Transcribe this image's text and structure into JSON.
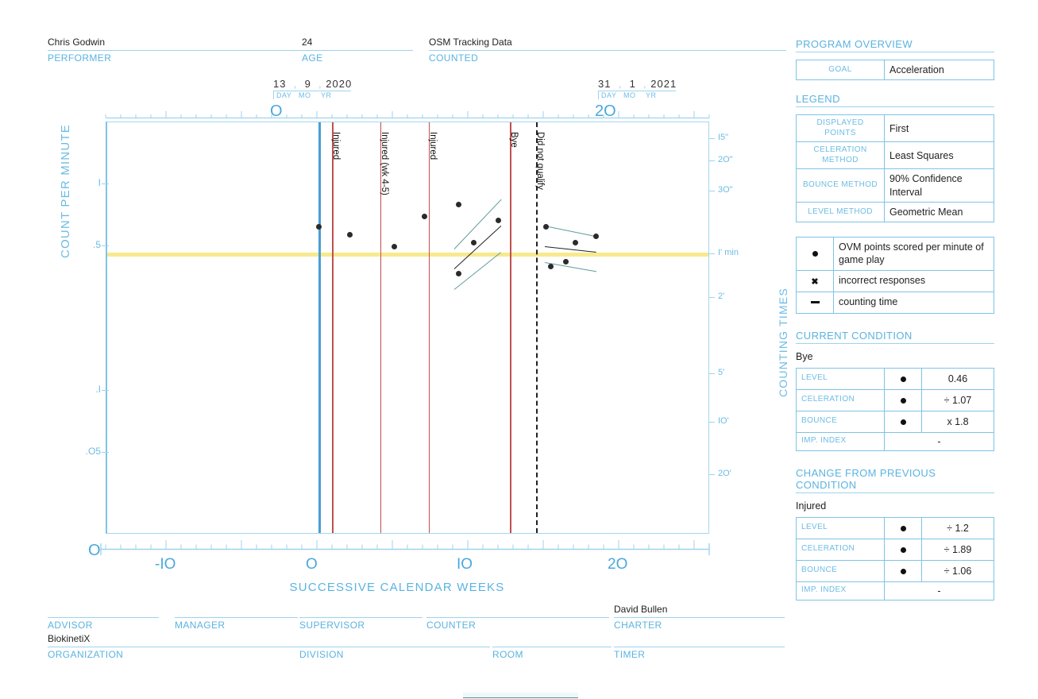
{
  "header": {
    "fields": [
      {
        "name": "performer",
        "label": "PERFORMER",
        "value": "Chris Godwin"
      },
      {
        "name": "age",
        "label": "AGE",
        "value": "24"
      },
      {
        "name": "counted",
        "label": "COUNTED",
        "value": "OSM Tracking Data"
      }
    ],
    "start_date": {
      "day": "13",
      "mo": "9",
      "yr": "2020",
      "units": [
        "DAY",
        "MO",
        "YR"
      ],
      "week": "O"
    },
    "end_date": {
      "day": "31",
      "mo": "1",
      "yr": "2021",
      "units": [
        "DAY",
        "MO",
        "YR"
      ],
      "week": "2O"
    }
  },
  "panel": {
    "program_overview": {
      "title": "PROGRAM OVERVIEW",
      "rows": [
        {
          "key": "GOAL",
          "value": "Acceleration"
        }
      ]
    },
    "legend": {
      "title": "LEGEND",
      "rows": [
        {
          "key": "DISPLAYED POINTS",
          "value": "First"
        },
        {
          "key": "CELERATION METHOD",
          "value": "Least Squares"
        },
        {
          "key": "BOUNCE METHOD",
          "value": "90% Confidence Interval"
        },
        {
          "key": "LEVEL METHOD",
          "value": "Geometric Mean"
        }
      ],
      "symbols": [
        {
          "symbol": "dot",
          "label": "OVM points scored per minute of game play"
        },
        {
          "symbol": "cross",
          "label": "incorrect responses"
        },
        {
          "symbol": "dash",
          "label": "counting time"
        }
      ]
    },
    "current_condition": {
      "title": "CURRENT CONDITION",
      "condition": "Bye",
      "rows": [
        {
          "key": "LEVEL",
          "symbol": "dot",
          "value": "0.46"
        },
        {
          "key": "CELERATION",
          "symbol": "dot",
          "value": "÷ 1.07"
        },
        {
          "key": "BOUNCE",
          "symbol": "dot",
          "value": "x 1.8"
        },
        {
          "key": "IMP. INDEX",
          "symbol": "",
          "value": "-"
        }
      ]
    },
    "change_from_previous": {
      "title": "CHANGE FROM PREVIOUS CONDITION",
      "condition": "Injured",
      "rows": [
        {
          "key": "LEVEL",
          "symbol": "dot",
          "value": "÷ 1.2"
        },
        {
          "key": "CELERATION",
          "symbol": "dot",
          "value": "÷ 1.89"
        },
        {
          "key": "BOUNCE",
          "symbol": "dot",
          "value": "÷ 1.06"
        },
        {
          "key": "IMP. INDEX",
          "symbol": "",
          "value": "-"
        }
      ]
    }
  },
  "footer": {
    "row1": [
      {
        "name": "advisor",
        "label": "ADVISOR",
        "value": ""
      },
      {
        "name": "manager",
        "label": "MANAGER",
        "value": ""
      },
      {
        "name": "supervisor",
        "label": "SUPERVISOR",
        "value": ""
      },
      {
        "name": "counter",
        "label": "COUNTER",
        "value": ""
      },
      {
        "name": "charter",
        "label": "CHARTER",
        "value": "David Bullen"
      }
    ],
    "row2": [
      {
        "name": "organization",
        "label": "ORGANIZATION",
        "value": "BiokinetiX"
      },
      {
        "name": "division",
        "label": "DIVISION",
        "value": ""
      },
      {
        "name": "room",
        "label": "ROOM",
        "value": ""
      },
      {
        "name": "timer",
        "label": "TIMER",
        "value": ""
      }
    ]
  },
  "chart_data": {
    "type": "scatter",
    "title": "",
    "xlabel": "SUCCESSIVE CALENDAR WEEKS",
    "ylabel": "COUNT PER MINUTE",
    "y2label": "COUNTING TIMES",
    "xlim": [
      -14,
      26
    ],
    "xticks": [
      -10,
      0,
      10,
      20
    ],
    "xticklabels": [
      "-IO",
      "O",
      "IO",
      "2O"
    ],
    "ylim": [
      0.02,
      2.0
    ],
    "yticklabels": [
      "I",
      ".5",
      ".I",
      ".O5"
    ],
    "yticks": [
      1,
      0.5,
      0.1,
      0.05
    ],
    "y2ticklabels": [
      "I5\"",
      "2O\"",
      "3O\"",
      "I' min",
      "2'",
      "5'",
      "IO'",
      "2O'"
    ],
    "grid": false,
    "aim_line": {
      "value": 0.46,
      "color": "#f7e98e"
    },
    "axis_color": "#6cbce4",
    "point_color": "#2b2b2b",
    "phase_lines": [
      {
        "label": "",
        "week": 0,
        "style": "solid",
        "color": "#4a9fd4"
      },
      {
        "label": "Injured",
        "week": 0.9,
        "style": "solid",
        "color": "#c0504d"
      },
      {
        "label": "Injured (wk 4-5)",
        "week": 4.1,
        "style": "solid",
        "color": "#c0504d"
      },
      {
        "label": "Injured",
        "week": 7.3,
        "style": "solid",
        "color": "#c0504d"
      },
      {
        "label": "Bye",
        "week": 12.7,
        "style": "solid",
        "color": "#c0504d"
      },
      {
        "label": "Did not qualify",
        "week": 14.4,
        "style": "dashed",
        "color": "#222222"
      }
    ],
    "series": [
      {
        "name": "OVM points scored per minute of game play",
        "symbol": "dot",
        "points": [
          {
            "x": 0.0,
            "y": 0.62
          },
          {
            "x": 2.1,
            "y": 0.57
          },
          {
            "x": 5.0,
            "y": 0.5
          },
          {
            "x": 7.0,
            "y": 0.7
          },
          {
            "x": 9.3,
            "y": 0.8
          },
          {
            "x": 10.3,
            "y": 0.52
          },
          {
            "x": 9.3,
            "y": 0.37
          },
          {
            "x": 11.9,
            "y": 0.67
          },
          {
            "x": 15.1,
            "y": 0.62
          },
          {
            "x": 17.0,
            "y": 0.52
          },
          {
            "x": 18.4,
            "y": 0.56
          },
          {
            "x": 16.4,
            "y": 0.42
          },
          {
            "x": 15.4,
            "y": 0.4
          }
        ]
      }
    ],
    "celeration_lines": [
      {
        "phase": "Injured",
        "x1": 9.0,
        "y1": 0.39,
        "x2": 12.1,
        "y2": 0.63,
        "color": "#222222"
      },
      {
        "phase": "Bye",
        "x1": 15.0,
        "y1": 0.5,
        "x2": 18.4,
        "y2": 0.47,
        "color": "#222222"
      }
    ],
    "bounce_lines": [
      {
        "phase": "Injured",
        "x1": 9.0,
        "y1": 0.49,
        "x2": 12.1,
        "y2": 0.85,
        "color": "#5f9e9a"
      },
      {
        "phase": "Injured",
        "x1": 9.0,
        "y1": 0.31,
        "x2": 12.1,
        "y2": 0.47,
        "color": "#5f9e9a"
      },
      {
        "phase": "Bye",
        "x1": 15.0,
        "y1": 0.63,
        "x2": 18.4,
        "y2": 0.56,
        "color": "#5f9e9a"
      },
      {
        "phase": "Bye",
        "x1": 15.0,
        "y1": 0.42,
        "x2": 18.4,
        "y2": 0.38,
        "color": "#5f9e9a"
      }
    ]
  }
}
